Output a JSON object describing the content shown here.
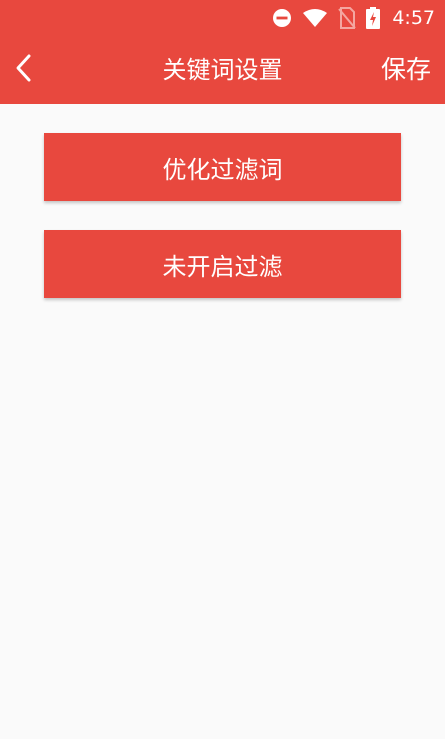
{
  "status_bar": {
    "time": "4:57",
    "icons": [
      "do-not-disturb-icon",
      "wifi-icon",
      "no-sim-icon",
      "battery-charging-icon"
    ]
  },
  "toolbar": {
    "back_icon": "chevron-left-icon",
    "title": "关键词设置",
    "save_label": "保存"
  },
  "buttons": {
    "optimize_filter_label": "优化过滤词",
    "filter_status_label": "未开启过滤"
  },
  "colors": {
    "primary": "#e8483e",
    "background": "#fafafa",
    "text_on_primary": "#ffffff"
  }
}
